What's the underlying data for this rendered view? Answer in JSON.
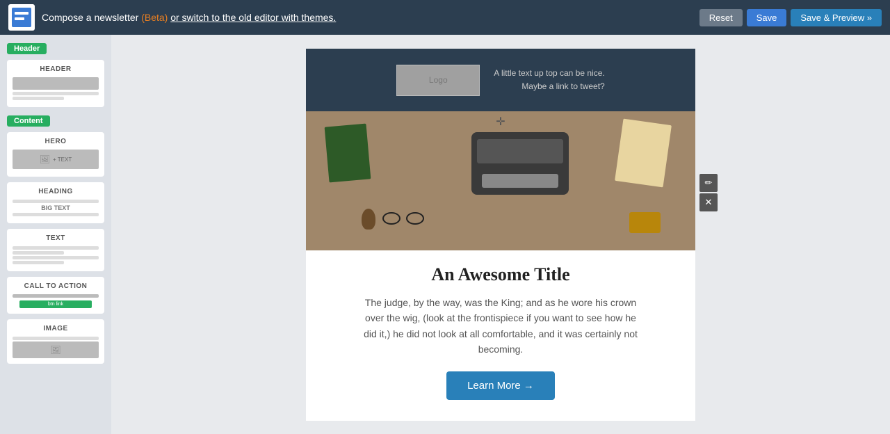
{
  "topbar": {
    "title_compose": "Compose a newsletter",
    "title_beta": "(Beta)",
    "title_link": "or switch to the old editor with themes.",
    "btn_reset": "Reset",
    "btn_save": "Save",
    "btn_save_preview": "Save & Preview »"
  },
  "sidebar": {
    "badge_header": "Header",
    "badge_content": "Content",
    "blocks": [
      {
        "id": "header",
        "label": "HEADER"
      },
      {
        "id": "hero",
        "label": "HERO"
      },
      {
        "id": "heading",
        "label": "HEADING"
      },
      {
        "id": "text",
        "label": "TEXT"
      },
      {
        "id": "call-to-action",
        "label": "CALL TO ACTION"
      },
      {
        "id": "image",
        "label": "IMAGE"
      }
    ]
  },
  "email": {
    "header": {
      "logo_placeholder": "Logo",
      "right_text_line1": "A little text up top can be nice.",
      "right_text_line2": "Maybe a link to tweet?"
    },
    "hero": {
      "title": "An Awesome Title",
      "body": "The judge, by the way, was the King; and as he wore his crown over the wig, (look at the frontispiece if you want to see how he did it,) he did not look at all comfortable, and it was certainly not becoming.",
      "cta": "Learn More →"
    }
  },
  "icons": {
    "move": "✛",
    "edit": "✏",
    "delete": "✕"
  }
}
